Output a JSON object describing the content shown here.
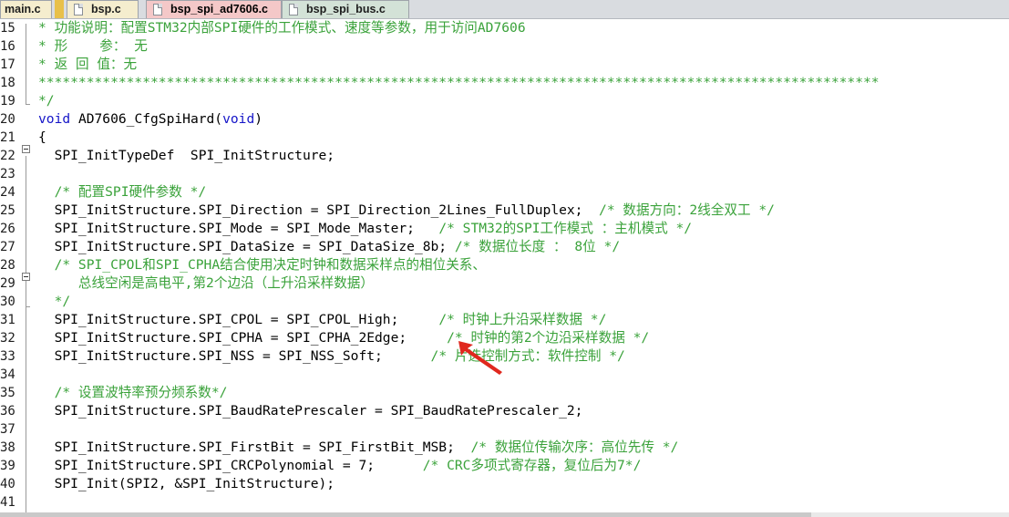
{
  "tabs": [
    {
      "label": "main.c"
    },
    {
      "label": "bsp.c"
    },
    {
      "label": "bsp_spi_ad7606.c",
      "active": true
    },
    {
      "label": "bsp_spi_bus.c"
    }
  ],
  "colors": {
    "keyword": "#1515c8",
    "comment": "#3aa23a",
    "arrow": "#e0281e"
  },
  "icons": {
    "tab_icon": "file-icon",
    "fold_icon": "fold-minus-icon",
    "annotation": "red-arrow-icon"
  },
  "lines": [
    {
      "num": "15",
      "text": "* 功能说明：配置STM32内部SPI硬件的工作模式、速度等参数，用于访问AD7606"
    },
    {
      "num": "16",
      "text": "* 形    参： 无"
    },
    {
      "num": "17",
      "text": "* 返 回 值：无"
    },
    {
      "num": "18",
      "text": "*********************************************************************************************************"
    },
    {
      "num": "19",
      "text": "*/"
    },
    {
      "num": "20",
      "kw": "void",
      "text": " AD7606_CfgSpiHard(",
      "kw2": "void",
      "text2": ")"
    },
    {
      "num": "21",
      "text": "{"
    },
    {
      "num": "22",
      "text": "  SPI_InitTypeDef  SPI_InitStructure;"
    },
    {
      "num": "23",
      "text": ""
    },
    {
      "num": "24",
      "text": "  /* 配置SPI硬件参数 */"
    },
    {
      "num": "25",
      "text": "  SPI_InitStructure.SPI_Direction = SPI_Direction_2Lines_FullDuplex;  ",
      "comment": "/* 数据方向：2线全双工 */"
    },
    {
      "num": "26",
      "text": "  SPI_InitStructure.SPI_Mode = SPI_Mode_Master;   ",
      "comment": "/* STM32的SPI工作模式 ：主机模式 */"
    },
    {
      "num": "27",
      "text": "  SPI_InitStructure.SPI_DataSize = SPI_DataSize_8b; ",
      "comment": "/* 数据位长度 ： 8位 */"
    },
    {
      "num": "28",
      "text": "  /* SPI_CPOL和SPI_CPHA结合使用决定时钟和数据采样点的相位关系、"
    },
    {
      "num": "29",
      "text": "     总线空闲是高电平,第2个边沿（上升沿采样数据）"
    },
    {
      "num": "30",
      "text": "  */"
    },
    {
      "num": "31",
      "text": "  SPI_InitStructure.SPI_CPOL = SPI_CPOL_High;     ",
      "comment": "/* 时钟上升沿采样数据 */"
    },
    {
      "num": "32",
      "text": "  SPI_InitStructure.SPI_CPHA = SPI_CPHA_2Edge;     ",
      "comment": "/* 时钟的第2个边沿采样数据 */"
    },
    {
      "num": "33",
      "text": "  SPI_InitStructure.SPI_NSS = SPI_NSS_Soft;      ",
      "comment": "/* 片选控制方式：软件控制 */"
    },
    {
      "num": "34",
      "text": ""
    },
    {
      "num": "35",
      "text": "  /* 设置波特率预分频系数*/"
    },
    {
      "num": "36",
      "text": "  SPI_InitStructure.SPI_BaudRatePrescaler = SPI_BaudRatePrescaler_2;"
    },
    {
      "num": "37",
      "text": ""
    },
    {
      "num": "38",
      "text": "  SPI_InitStructure.SPI_FirstBit = SPI_FirstBit_MSB;  ",
      "comment": "/* 数据位传输次序：高位先传 */"
    },
    {
      "num": "39",
      "text": "  SPI_InitStructure.SPI_CRCPolynomial = 7;      ",
      "comment": "/* CRC多项式寄存器，复位后为7*/"
    },
    {
      "num": "40",
      "text": "  SPI_Init(SPI2, &SPI_InitStructure);"
    },
    {
      "num": "41",
      "text": ""
    }
  ]
}
